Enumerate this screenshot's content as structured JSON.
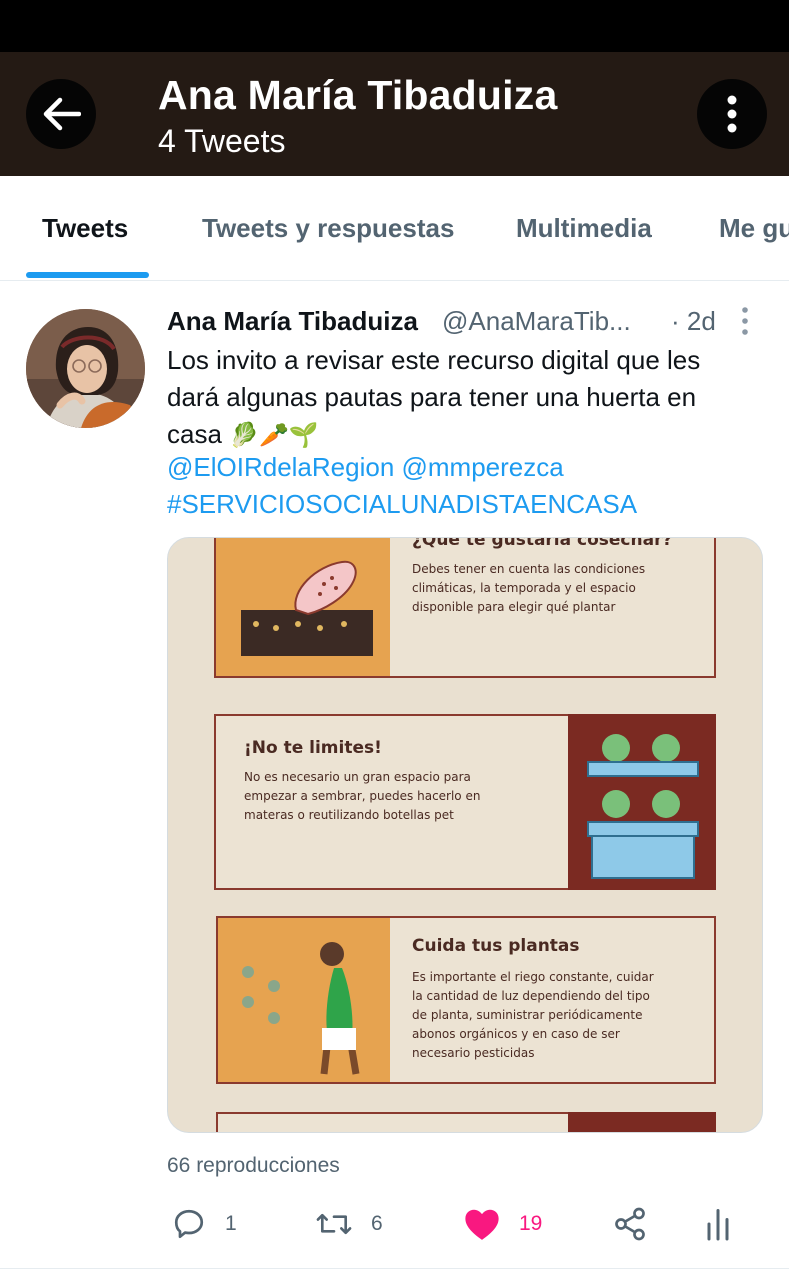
{
  "header": {
    "back_icon": "arrow-left-icon",
    "title": "Ana María Tibaduiza",
    "subtitle": "4 Tweets",
    "more_icon": "more-vertical-icon",
    "background": "#241a14"
  },
  "tabs": [
    {
      "label": "Tweets",
      "active": true
    },
    {
      "label": "Tweets y respuestas",
      "active": false
    },
    {
      "label": "Multimedia",
      "active": false
    },
    {
      "label": "Me gu",
      "active": false
    }
  ],
  "tweet": {
    "author_name": "Ana María Tibaduiza",
    "author_handle": "@AnaMaraTib...",
    "time": "· 2d",
    "text": "Los invito a revisar este recurso digital que les dará algunas pautas para tener una huerta en casa",
    "text_emoji": "🥬🥕🌱",
    "mentions": "@ElOIRdelaRegion @mmperezca",
    "hashtag": "#SERVICIOSOCIALUNADISTAENCASA",
    "media": {
      "card1": {
        "title": "¿Qué te gustaría cosechar?",
        "body": [
          "Debes tener en cuenta las condiciones",
          "climáticas, la temporada y el espacio",
          "disponible para elegir qué plantar"
        ]
      },
      "card2": {
        "title": "¡No te limites!",
        "body": [
          "No es necesario un gran espacio para",
          "empezar a sembrar, puedes hacerlo en",
          "materas o reutilizando botellas pet"
        ]
      },
      "card3": {
        "title": "Cuida tus plantas",
        "body": [
          "Es importante el riego constante, cuidar",
          "la cantidad de luz dependiendo del tipo",
          "de planta, suministrar periódicamente",
          "abonos orgánicos y en caso de ser",
          "necesario pesticidas"
        ]
      }
    },
    "views": "66 reproducciones",
    "actions": {
      "reply": {
        "icon": "reply-icon",
        "count": "1"
      },
      "retweet": {
        "icon": "retweet-icon",
        "count": "6"
      },
      "like": {
        "icon": "heart-icon",
        "count": "19",
        "color": "#f91880"
      },
      "share": {
        "icon": "share-icon"
      },
      "analytics": {
        "icon": "analytics-icon"
      }
    }
  },
  "colors": {
    "accent": "#1d9bf0",
    "muted": "#536471",
    "like": "#f91880"
  }
}
